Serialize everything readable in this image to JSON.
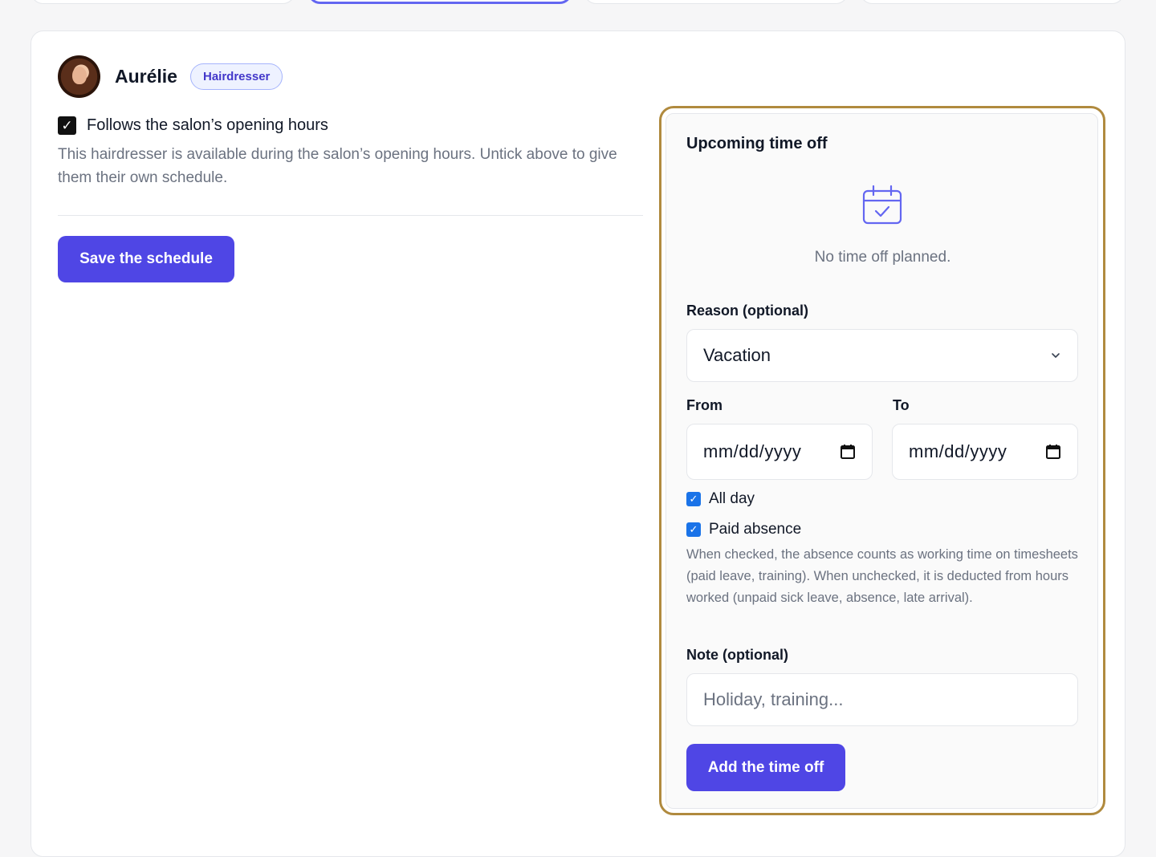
{
  "staff": {
    "name": "Aurélie",
    "role": "Hairdresser"
  },
  "schedule": {
    "follow_label": "Follows the salon’s opening hours",
    "follow_checked": true,
    "follow_help": "This hairdresser is available during the salon’s opening hours. Untick above to give them their own schedule.",
    "save_label": "Save the schedule"
  },
  "time_off": {
    "title": "Upcoming time off",
    "empty_icon": "calendar-check-icon",
    "empty_text": "No time off planned.",
    "reason_label": "Reason (optional)",
    "reason_value": "Vacation",
    "from_label": "From",
    "from_value": "mm/dd/yyyy",
    "to_label": "To",
    "to_value": "mm/dd/yyyy",
    "all_day_label": "All day",
    "all_day_checked": true,
    "paid_label": "Paid absence",
    "paid_checked": true,
    "paid_help": "When checked, the absence counts as working time on timesheets (paid leave, training). When unchecked, it is deducted from hours worked (unpaid sick leave, absence, late arrival).",
    "note_label": "Note (optional)",
    "note_placeholder": "Holiday, training...",
    "add_label": "Add the time off"
  },
  "colors": {
    "accent": "#4f46e5",
    "badge_text": "#4338ca",
    "highlight_border": "#b08a3e",
    "muted_text": "#6b7280"
  }
}
